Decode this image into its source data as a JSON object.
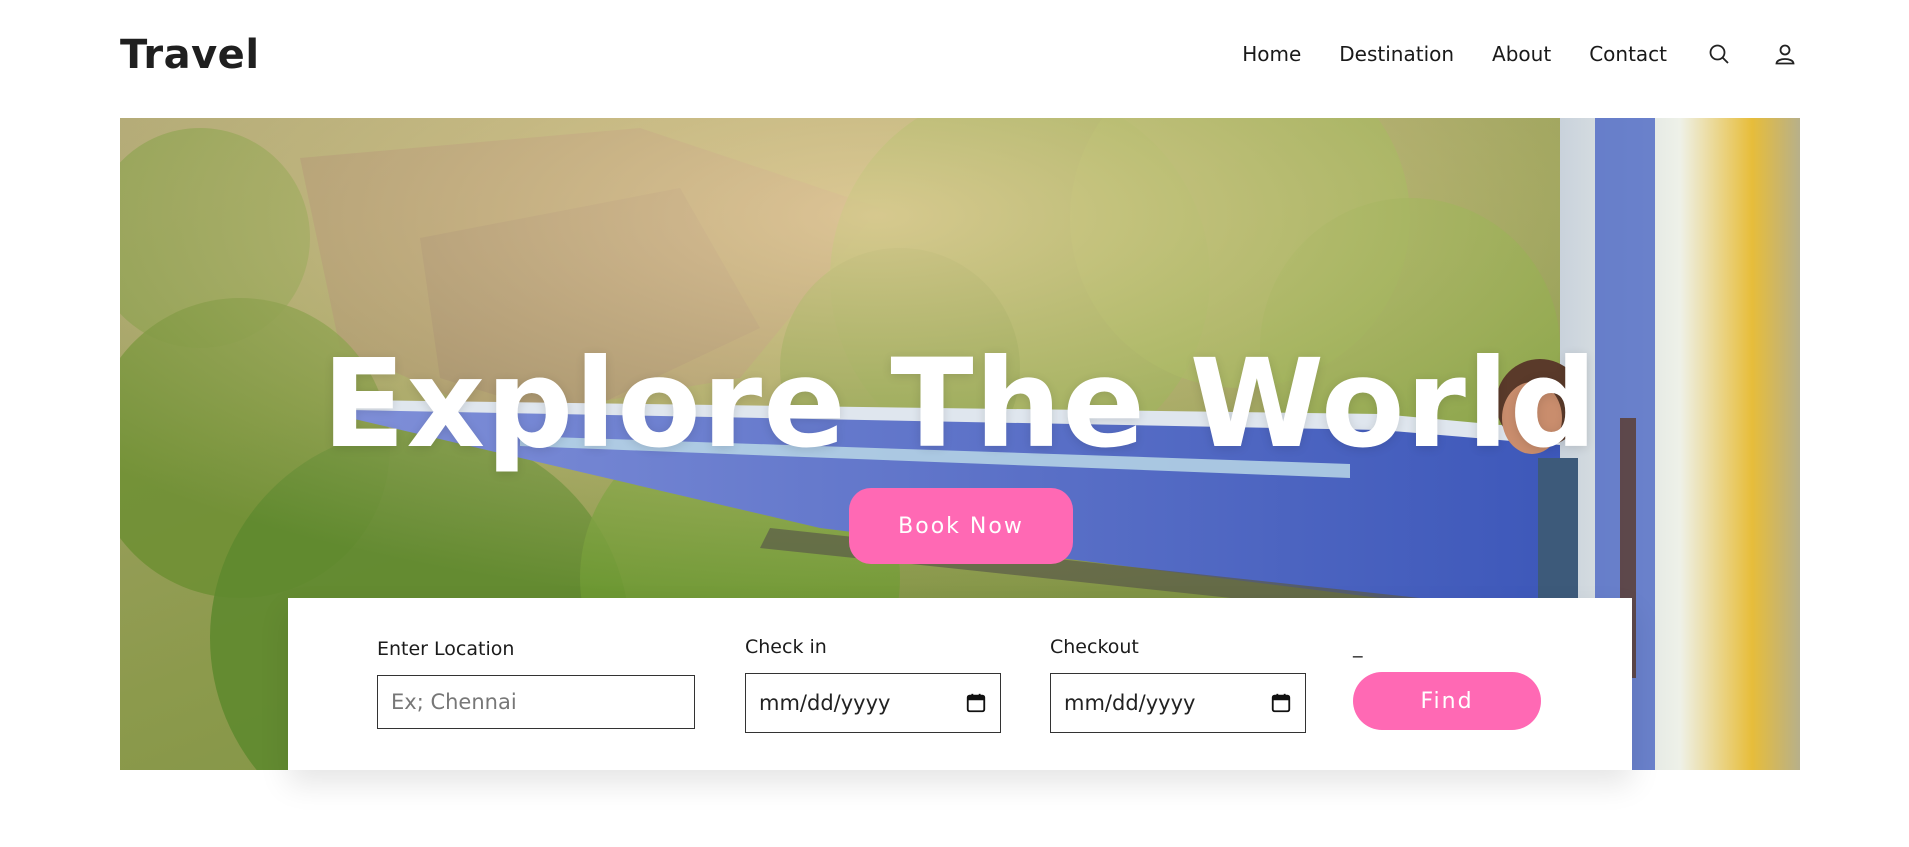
{
  "brand": {
    "name": "Travel"
  },
  "nav": {
    "links": [
      "Home",
      "Destination",
      "About",
      "Contact"
    ],
    "icons": [
      "search-icon",
      "user-icon"
    ]
  },
  "hero": {
    "title": "Explore The World",
    "button_label": "Book Now"
  },
  "search": {
    "location_label": "Enter Location",
    "location_placeholder": "Ex; Chennai",
    "checkin_label": "Check in",
    "checkin_value": "mm/dd/yyyy",
    "checkout_label": "Checkout",
    "checkout_value": "mm/dd/yyyy",
    "find_label_above": "_",
    "find_button": "Find"
  },
  "colors": {
    "accent": "#ff69b4",
    "text": "#1f1f1f"
  }
}
